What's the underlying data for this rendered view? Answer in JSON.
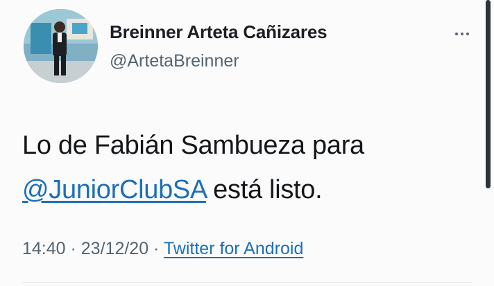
{
  "tweet": {
    "author_name": "Breinner Arteta Cañizares",
    "author_handle": "@ArtetaBreinner",
    "text_before": "Lo de Fabián Sambueza para",
    "mention": "@JuniorClubSA",
    "text_after": " está listo.",
    "time": "14:40",
    "separator1": " · ",
    "date": "23/12/20",
    "separator2": " · ",
    "source": "Twitter for Android"
  },
  "icons": {
    "avatar": "profile-photo",
    "more": "more-horizontal-icon"
  },
  "colors": {
    "link": "#1d6fb8",
    "secondary_text": "#536471",
    "primary_text": "#14171a"
  }
}
